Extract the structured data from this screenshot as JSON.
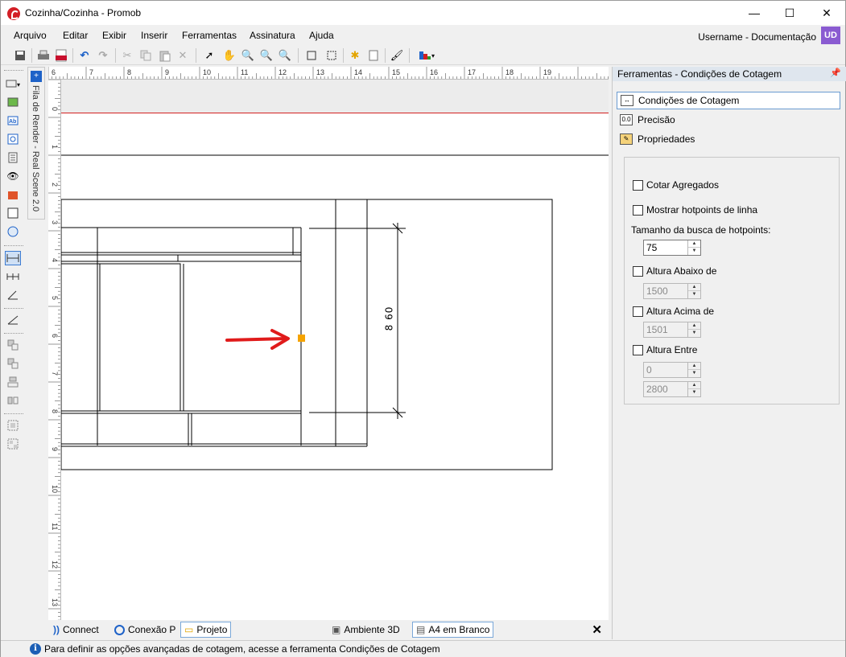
{
  "window": {
    "title": "Cozinha/Cozinha - Promob",
    "minimize": "—",
    "maximize": "☐",
    "close": "✕"
  },
  "menu": {
    "items": [
      "Arquivo",
      "Editar",
      "Exibir",
      "Inserir",
      "Ferramentas",
      "Assinatura",
      "Ajuda"
    ],
    "user": "Username - Documentação",
    "avatar": "UD"
  },
  "side_tab": {
    "label": "Fila de Render - Real Scene 2.0"
  },
  "ruler": {
    "top_labels": [
      "6",
      "7",
      "8",
      "9",
      "10",
      "11",
      "12",
      "13",
      "14",
      "15",
      "16",
      "17",
      "18",
      "19"
    ],
    "left_labels": [
      "0",
      "1",
      "2",
      "3",
      "4",
      "5",
      "6",
      "7",
      "8",
      "9",
      "10",
      "11",
      "12",
      "13"
    ]
  },
  "drawing": {
    "dimension_label": "8 60"
  },
  "bottom_tabs": {
    "connect": "Connect",
    "conexao": "Conexão P",
    "projeto": "Projeto",
    "ambiente": "Ambiente 3D",
    "a4": "A4 em Branco",
    "close": "✕"
  },
  "status": {
    "text": "Para definir as opções avançadas de cotagem, acesse a ferramenta Condições de Cotagem"
  },
  "panel": {
    "title": "Ferramentas - Condições de Cotagem",
    "items": [
      "Condições de Cotagem",
      "Precisão",
      "Propriedades"
    ],
    "cotar_agregados": "Cotar Agregados",
    "mostrar_hotpoints": "Mostrar hotpoints de linha",
    "tamanho_label": "Tamanho da busca de hotpoints:",
    "tamanho_value": "75",
    "altura_abaixo": "Altura Abaixo de",
    "altura_abaixo_value": "1500",
    "altura_acima": "Altura Acima de",
    "altura_acima_value": "1501",
    "altura_entre": "Altura Entre",
    "altura_entre_min": "0",
    "altura_entre_max": "2800"
  },
  "colors": {
    "accent": "#6a9bd1",
    "arrow": "#e01b1b",
    "hotpoint": "#f5a300"
  }
}
